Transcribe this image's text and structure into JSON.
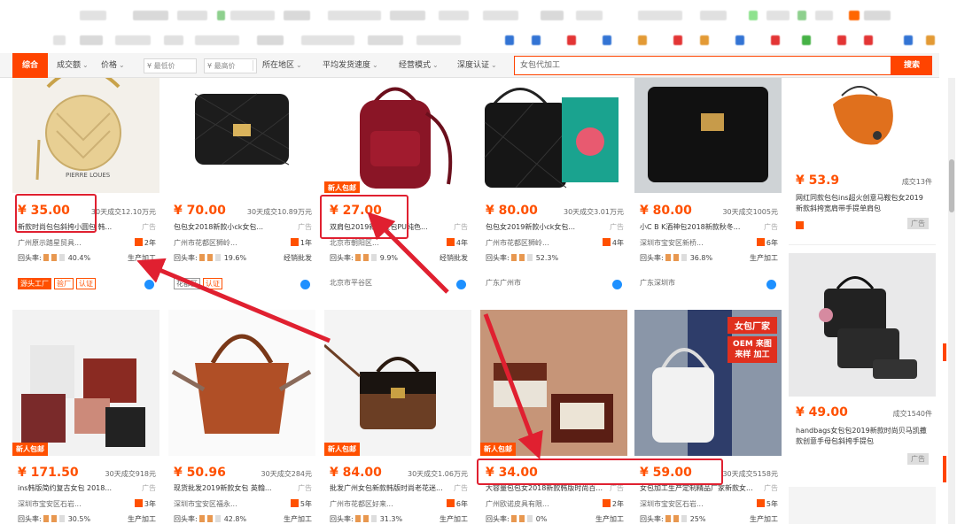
{
  "filter_bar": {
    "composite": "综合",
    "sales": "成交额",
    "price": "价格",
    "min_price": "¥ 最低价",
    "max_price": "¥ 最高价",
    "region": "所在地区",
    "ship_speed": "平均发货速度",
    "biz_mode": "经营模式",
    "depth_cert": "深度认证",
    "search_value": "女包代加工",
    "search_button": "搜索"
  },
  "products_row1": [
    {
      "price": "¥ 35.00",
      "sold": "30天成交12.10万元",
      "title": "新款时尚包包斜挎小圆包 韩...",
      "ad": "广告",
      "location": "广州原示踏星贸具...",
      "years": "2年",
      "repeat_label": "回头率:",
      "repeat": "40.4%",
      "biz": "生产加工",
      "badge": "",
      "tags": [
        "源头工厂",
        "验厂",
        "认证"
      ]
    },
    {
      "price": "¥ 70.00",
      "sold": "30天成交10.89万元",
      "title": "包包女2018新款小ck女包...",
      "ad": "广告",
      "location": "广州市花都区狮岭...",
      "years": "1年",
      "repeat_label": "回头率:",
      "repeat": "19.6%",
      "biz": "经销批发",
      "badge": "",
      "tags": [
        "花都区",
        "认证"
      ]
    },
    {
      "price": "¥ 27.00",
      "sold": "",
      "title": "双肩包2019新款女包PU纯色...",
      "ad": "广告",
      "location": "北京市朝阳区...",
      "years": "4年",
      "repeat_label": "回头率:",
      "repeat": "9.9%",
      "biz": "经销批发",
      "badge": "新人包邮",
      "tags": [
        "北京市平谷区"
      ]
    },
    {
      "price": "¥ 80.00",
      "sold": "30天成交3.01万元",
      "title": "包包女2019新款小ck女包...",
      "ad": "广告",
      "location": "广州市花都区狮岭...",
      "years": "4年",
      "repeat_label": "回头率:",
      "repeat": "52.3%",
      "biz": "",
      "badge": "",
      "tags": [
        "广东广州市"
      ]
    },
    {
      "price": "¥ 80.00",
      "sold": "30天成交1005元",
      "title": "小C B K酒神包2018新款秋冬...",
      "ad": "广告",
      "location": "深圳市宝安区新桥...",
      "years": "6年",
      "repeat_label": "回头率:",
      "repeat": "36.8%",
      "biz": "生产加工",
      "badge": "",
      "tags": [
        "广东深圳市"
      ]
    }
  ],
  "products_row2": [
    {
      "price": "¥ 171.50",
      "sold": "30天成交918元",
      "title": "ins韩版简约复古女包 2018...",
      "ad": "广告",
      "location": "深圳市宝安区石岩...",
      "years": "3年",
      "repeat_label": "回头率:",
      "repeat": "30.5%",
      "biz": "生产加工",
      "badge": "新人包邮"
    },
    {
      "price": "¥ 50.96",
      "sold": "30天成交284元",
      "title": "现货批发2019新款女包 英翰...",
      "ad": "广告",
      "location": "深圳市宝安区福永...",
      "years": "5年",
      "repeat_label": "回头率:",
      "repeat": "42.8%",
      "biz": "生产加工",
      "badge": ""
    },
    {
      "price": "¥ 84.00",
      "sold": "30天成交1.06万元",
      "title": "批发广州女包新款韩版时尚老花迷...",
      "ad": "广告",
      "location": "广州市花都区好来...",
      "years": "6年",
      "repeat_label": "回头率:",
      "repeat": "31.3%",
      "biz": "生产加工",
      "badge": "新人包邮"
    },
    {
      "price": "¥ 34.00",
      "sold": "",
      "title": "大容量包包女2018新款韩版时尚百...",
      "ad": "广告",
      "location": "广州欧诺皮具有限...",
      "years": "2年",
      "repeat_label": "回头率:",
      "repeat": "0%",
      "biz": "生产加工",
      "badge": "新人包邮"
    },
    {
      "price": "¥ 59.00",
      "sold": "30天成交5158元",
      "title": "女包加工生产定制精品厂家新款女...",
      "ad": "广告",
      "location": "深圳市宝安区石岩...",
      "years": "5年",
      "repeat_label": "回头率:",
      "repeat": "25%",
      "biz": "生产加工",
      "badge": ""
    }
  ],
  "right_column": [
    {
      "price": "¥ 53.9",
      "sold": "成交13件",
      "title": "网红同款包包ins超火创意马鞍包女2019新款斜挎宽肩带手提单肩包",
      "ad": "广告"
    },
    {
      "price": "¥ 49.00",
      "sold": "成交1540件",
      "title": "handbags女包包2019新款时尚贝马凯撒款创意手母包斜挎手提包",
      "ad": "广告"
    }
  ],
  "image_badges": {
    "oem_title": "女包厂家",
    "oem_body": "OEM 来图来样 加工"
  },
  "colors": {
    "accent": "#ff4400",
    "price": "#ff5000",
    "highlight": "#e02030"
  }
}
